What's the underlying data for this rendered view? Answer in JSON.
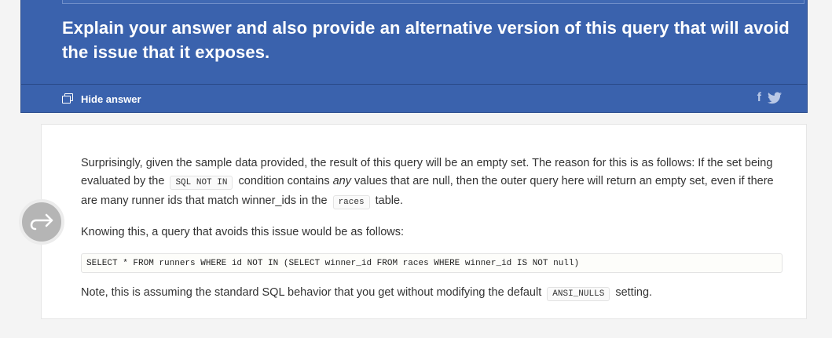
{
  "question": {
    "text": "Explain your answer and also provide an alternative version of this query that will avoid the issue that it exposes.",
    "hide_answer_label": "Hide answer",
    "social": {
      "facebook_icon": "facebook-icon",
      "twitter_icon": "twitter-icon",
      "facebook_glyph": "f"
    }
  },
  "answer": {
    "p1_a": "Surprisingly, given the sample data provided, the result of this query will be an empty set. The reason for this is as follows: If the set being evaluated by the",
    "p1_code1": "SQL NOT IN",
    "p1_b": "condition contains",
    "p1_em": "any",
    "p1_c": "values that are null, then the outer query here will return an empty set, even if there are many runner ids that match winner_ids in the",
    "p1_code2": "races",
    "p1_d": "table.",
    "p2": "Knowing this, a query that avoids this issue would be as follows:",
    "code": "SELECT * FROM runners WHERE id NOT IN (SELECT winner_id FROM races WHERE winner_id IS NOT null)",
    "p3_a": "Note, this is assuming the standard SQL behavior that you get without modifying the default",
    "p3_code": "ANSI_NULLS",
    "p3_b": "setting."
  },
  "next_button": {
    "icon": "arrow-right-icon"
  },
  "colors": {
    "header_bg": "#3a62ad",
    "page_bg": "#f4f4f4",
    "card_bg": "#ffffff",
    "next_button_bg": "#b5b5b5"
  }
}
